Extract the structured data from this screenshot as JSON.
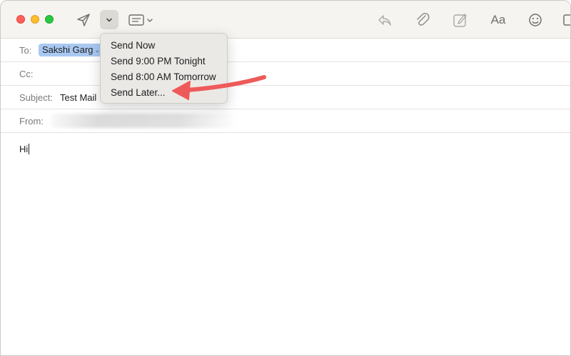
{
  "toolbar": {
    "icons": [
      "paper-plane-icon",
      "chevron-down-icon",
      "header-fields-icon",
      "reply-icon",
      "paperclip-icon",
      "markup-icon",
      "font-icon",
      "emoji-icon",
      "photo-icon"
    ],
    "font_label": "Aa"
  },
  "send_menu": {
    "items": [
      {
        "label": "Send Now"
      },
      {
        "label": "Send 9:00 PM Tonight"
      },
      {
        "label": "Send 8:00 AM Tomorrow"
      },
      {
        "label": "Send Later..."
      }
    ]
  },
  "compose": {
    "to_label": "To:",
    "to_recipient": "Sakshi Garg",
    "cc_label": "Cc:",
    "subject_label": "Subject:",
    "subject_value": "Test Mail",
    "from_label": "From:",
    "body": "Hi"
  },
  "colors": {
    "annotation_arrow": "#ee5a5a",
    "recipient_token": "#a9c9f2",
    "toolbar_bg": "#f6f4f0"
  }
}
